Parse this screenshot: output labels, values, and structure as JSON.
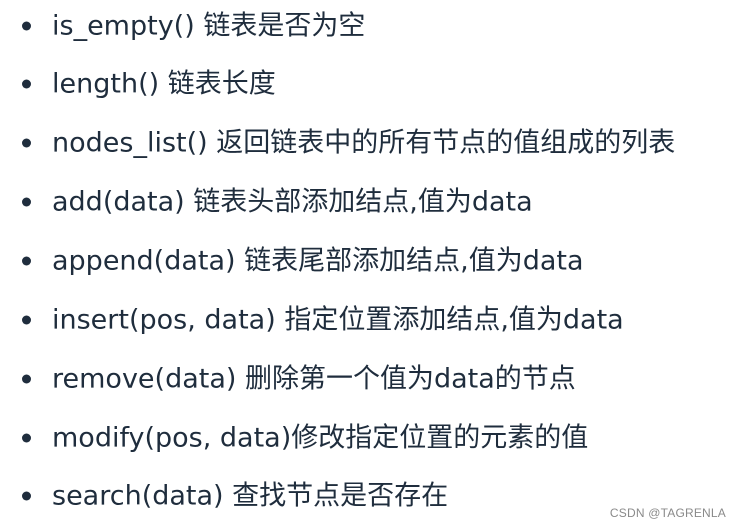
{
  "items": [
    {
      "text": "is_empty() 链表是否为空"
    },
    {
      "text": "length() 链表长度"
    },
    {
      "text": "nodes_list() 返回链表中的所有节点的值组成的列表"
    },
    {
      "text": "add(data) 链表头部添加结点,值为data"
    },
    {
      "text": "append(data) 链表尾部添加结点,值为data"
    },
    {
      "text": "insert(pos, data) 指定位置添加结点,值为data"
    },
    {
      "text": "remove(data) 删除第一个值为data的节点"
    },
    {
      "text": "modify(pos, data)修改指定位置的元素的值"
    },
    {
      "text": "search(data) 查找节点是否存在"
    }
  ],
  "watermark": "CSDN @TAGRENLA"
}
